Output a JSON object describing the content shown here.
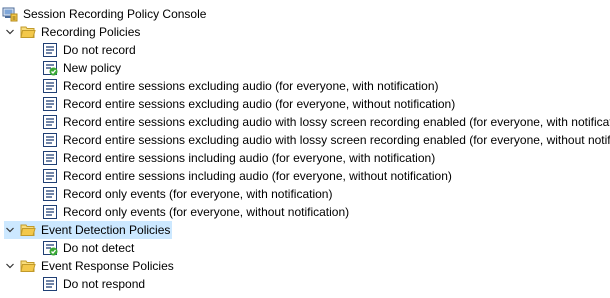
{
  "tree": {
    "root": {
      "label": "Session Recording Policy Console",
      "icon": "console-icon"
    },
    "groups": [
      {
        "label": "Recording Policies",
        "icon": "folder-open-icon",
        "expanded": true,
        "selected": false,
        "items": [
          {
            "label": "Do not record",
            "icon": "policy-icon",
            "active": false
          },
          {
            "label": "New policy",
            "icon": "policy-active-icon",
            "active": true
          },
          {
            "label": "Record entire sessions excluding audio (for everyone, with notification)",
            "icon": "policy-icon",
            "active": false
          },
          {
            "label": "Record entire sessions excluding audio (for everyone, without notification)",
            "icon": "policy-icon",
            "active": false
          },
          {
            "label": "Record entire sessions excluding audio with lossy screen recording enabled (for everyone, with notification)",
            "icon": "policy-icon",
            "active": false
          },
          {
            "label": "Record entire sessions excluding audio with lossy screen recording enabled (for everyone, without notification)",
            "icon": "policy-icon",
            "active": false
          },
          {
            "label": "Record entire sessions including audio (for everyone, with notification)",
            "icon": "policy-icon",
            "active": false
          },
          {
            "label": "Record entire sessions including audio (for everyone, without notification)",
            "icon": "policy-icon",
            "active": false
          },
          {
            "label": "Record only events (for everyone, with notification)",
            "icon": "policy-icon",
            "active": false
          },
          {
            "label": "Record only events (for everyone, without notification)",
            "icon": "policy-icon",
            "active": false
          }
        ]
      },
      {
        "label": "Event Detection Policies",
        "icon": "folder-open-icon",
        "expanded": true,
        "selected": true,
        "items": [
          {
            "label": "Do not detect",
            "icon": "policy-active-icon",
            "active": true
          }
        ]
      },
      {
        "label": "Event Response Policies",
        "icon": "folder-open-icon",
        "expanded": true,
        "selected": false,
        "items": [
          {
            "label": "Do not respond",
            "icon": "policy-icon",
            "active": false
          }
        ]
      }
    ]
  },
  "colors": {
    "selection": "#cce8ff",
    "folder": "#f3c84b",
    "check": "#3aa935"
  }
}
